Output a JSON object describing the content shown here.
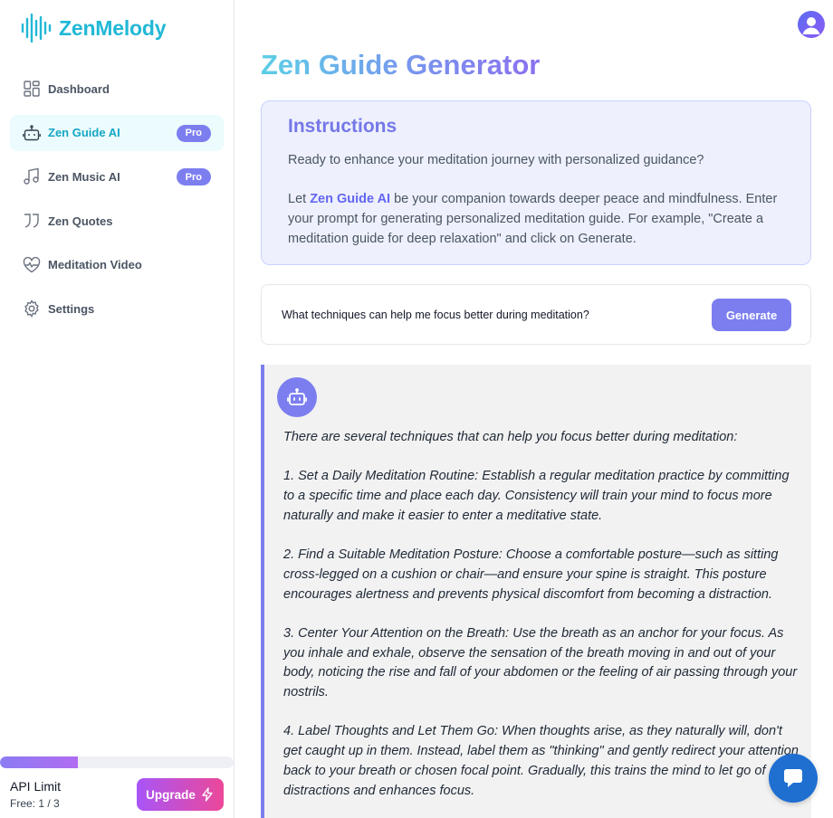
{
  "app": {
    "name": "ZenMelody"
  },
  "sidebar": {
    "items": [
      {
        "label": "Dashboard",
        "icon": "dashboard-icon",
        "active": false
      },
      {
        "label": "Zen Guide AI",
        "icon": "robot-icon",
        "active": true,
        "badge": "Pro"
      },
      {
        "label": "Zen Music AI",
        "icon": "music-icon",
        "active": false,
        "badge": "Pro"
      },
      {
        "label": "Zen Quotes",
        "icon": "quote-icon",
        "active": false
      },
      {
        "label": "Meditation Video",
        "icon": "heart-pulse-icon",
        "active": false
      },
      {
        "label": "Settings",
        "icon": "gear-icon",
        "active": false
      }
    ],
    "usage": {
      "title": "API Limit",
      "count_label": "Free: 1 / 3",
      "used": 1,
      "limit": 3,
      "upgrade_label": "Upgrade"
    }
  },
  "main": {
    "title": "Zen Guide Generator",
    "instructions": {
      "heading": "Instructions",
      "line1": "Ready to enhance your meditation journey with personalized guidance?",
      "line2_prefix": "Let ",
      "line2_link": "Zen Guide AI",
      "line2_suffix": " be your companion towards deeper peace and mindfulness. Enter your prompt for generating personalized meditation guide. For example, \"Create a meditation guide for deep relaxation\" and click on Generate."
    },
    "prompt": {
      "value": "What techniques can help me focus better during meditation?",
      "generate_label": "Generate"
    },
    "response": {
      "paragraphs": [
        "There are several techniques that can help you focus better during meditation:",
        "1. Set a Daily Meditation Routine: Establish a regular meditation practice by committing to a specific time and place each day. Consistency will train your mind to focus more naturally and make it easier to enter a meditative state.",
        "2. Find a Suitable Meditation Posture: Choose a comfortable posture—such as sitting cross-legged on a cushion or chair—and ensure your spine is straight. This posture encourages alertness and prevents physical discomfort from becoming a distraction.",
        "3. Center Your Attention on the Breath: Use the breath as an anchor for your focus. As you inhale and exhale, observe the sensation of the breath moving in and out of your body, noticing the rise and fall of your abdomen or the feeling of air passing through your nostrils.",
        "4. Label Thoughts and Let Them Go: When thoughts arise, as they naturally will, don't get caught up in them. Instead, label them as \"thinking\" and gently redirect your attention back to your breath or chosen focal point. Gradually, this trains the mind to let go of distractions and enhances focus."
      ]
    }
  },
  "colors": {
    "brand": "#22b8d6",
    "accent": "#7c7ef0",
    "upgrade_from": "#a855f7",
    "upgrade_to": "#ec4899",
    "chat": "#1f6fd1"
  }
}
